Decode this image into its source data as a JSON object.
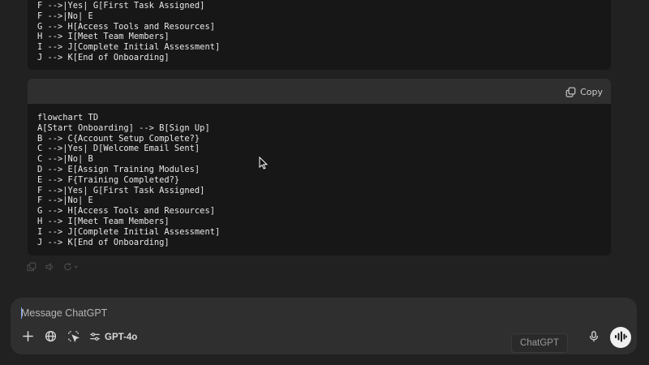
{
  "previous_code": {
    "lines": "F -->|Yes| G[First Task Assigned]\nF -->|No| E\nG --> H[Access Tools and Resources]\nH --> I[Meet Team Members]\nI --> J[Complete Initial Assessment]\nJ --> K[End of Onboarding]"
  },
  "code_block": {
    "copy_label": "Copy",
    "code": "flowchart TD\nA[Start Onboarding] --> B[Sign Up]\nB --> C{Account Setup Complete?}\nC -->|Yes| D[Welcome Email Sent]\nC -->|No| B\nD --> E[Assign Training Modules]\nE --> F{Training Completed?}\nF -->|Yes| G[First Task Assigned]\nF -->|No| E\nG --> H[Access Tools and Resources]\nH --> I[Meet Team Members]\nI --> J[Complete Initial Assessment]\nJ --> K[End of Onboarding]"
  },
  "composer": {
    "placeholder": "Message ChatGPT",
    "value": "",
    "model_label": "GPT-4o",
    "tooltip": "ChatGPT"
  },
  "icons": {
    "copy": "copy-icon",
    "attach": "plus-icon",
    "web": "globe-icon",
    "canvas": "cursor-select-icon",
    "tools": "sliders-icon",
    "mic": "microphone-icon",
    "voice": "waveform-icon"
  },
  "colors": {
    "background": "#212121",
    "code_bg": "#171717",
    "code_header": "#2f2f2f",
    "composer_bg": "#2f2f2f",
    "voice_button": "#f0f0f0"
  }
}
